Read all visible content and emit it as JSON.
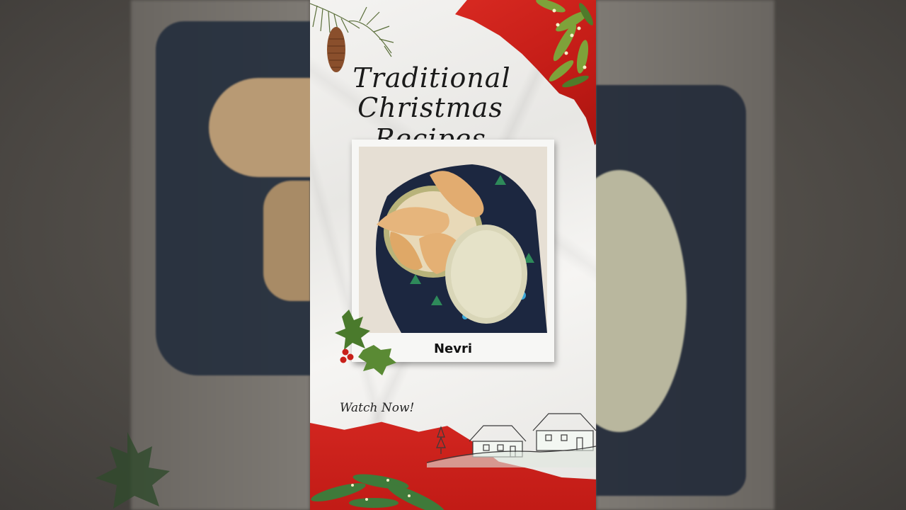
{
  "poster": {
    "title_line1": "Traditional",
    "title_line2": "Christmas Recipes",
    "recipe_name": "Nevri",
    "watch_label": "Watch Now!"
  },
  "colors": {
    "accent_red": "#c8201a",
    "pine_green": "#3f7a3a",
    "paper": "#f1f0ee"
  },
  "icons": [
    "pine-cone-icon",
    "holly-icon",
    "pine-branch-icon",
    "houses-sketch-icon"
  ]
}
